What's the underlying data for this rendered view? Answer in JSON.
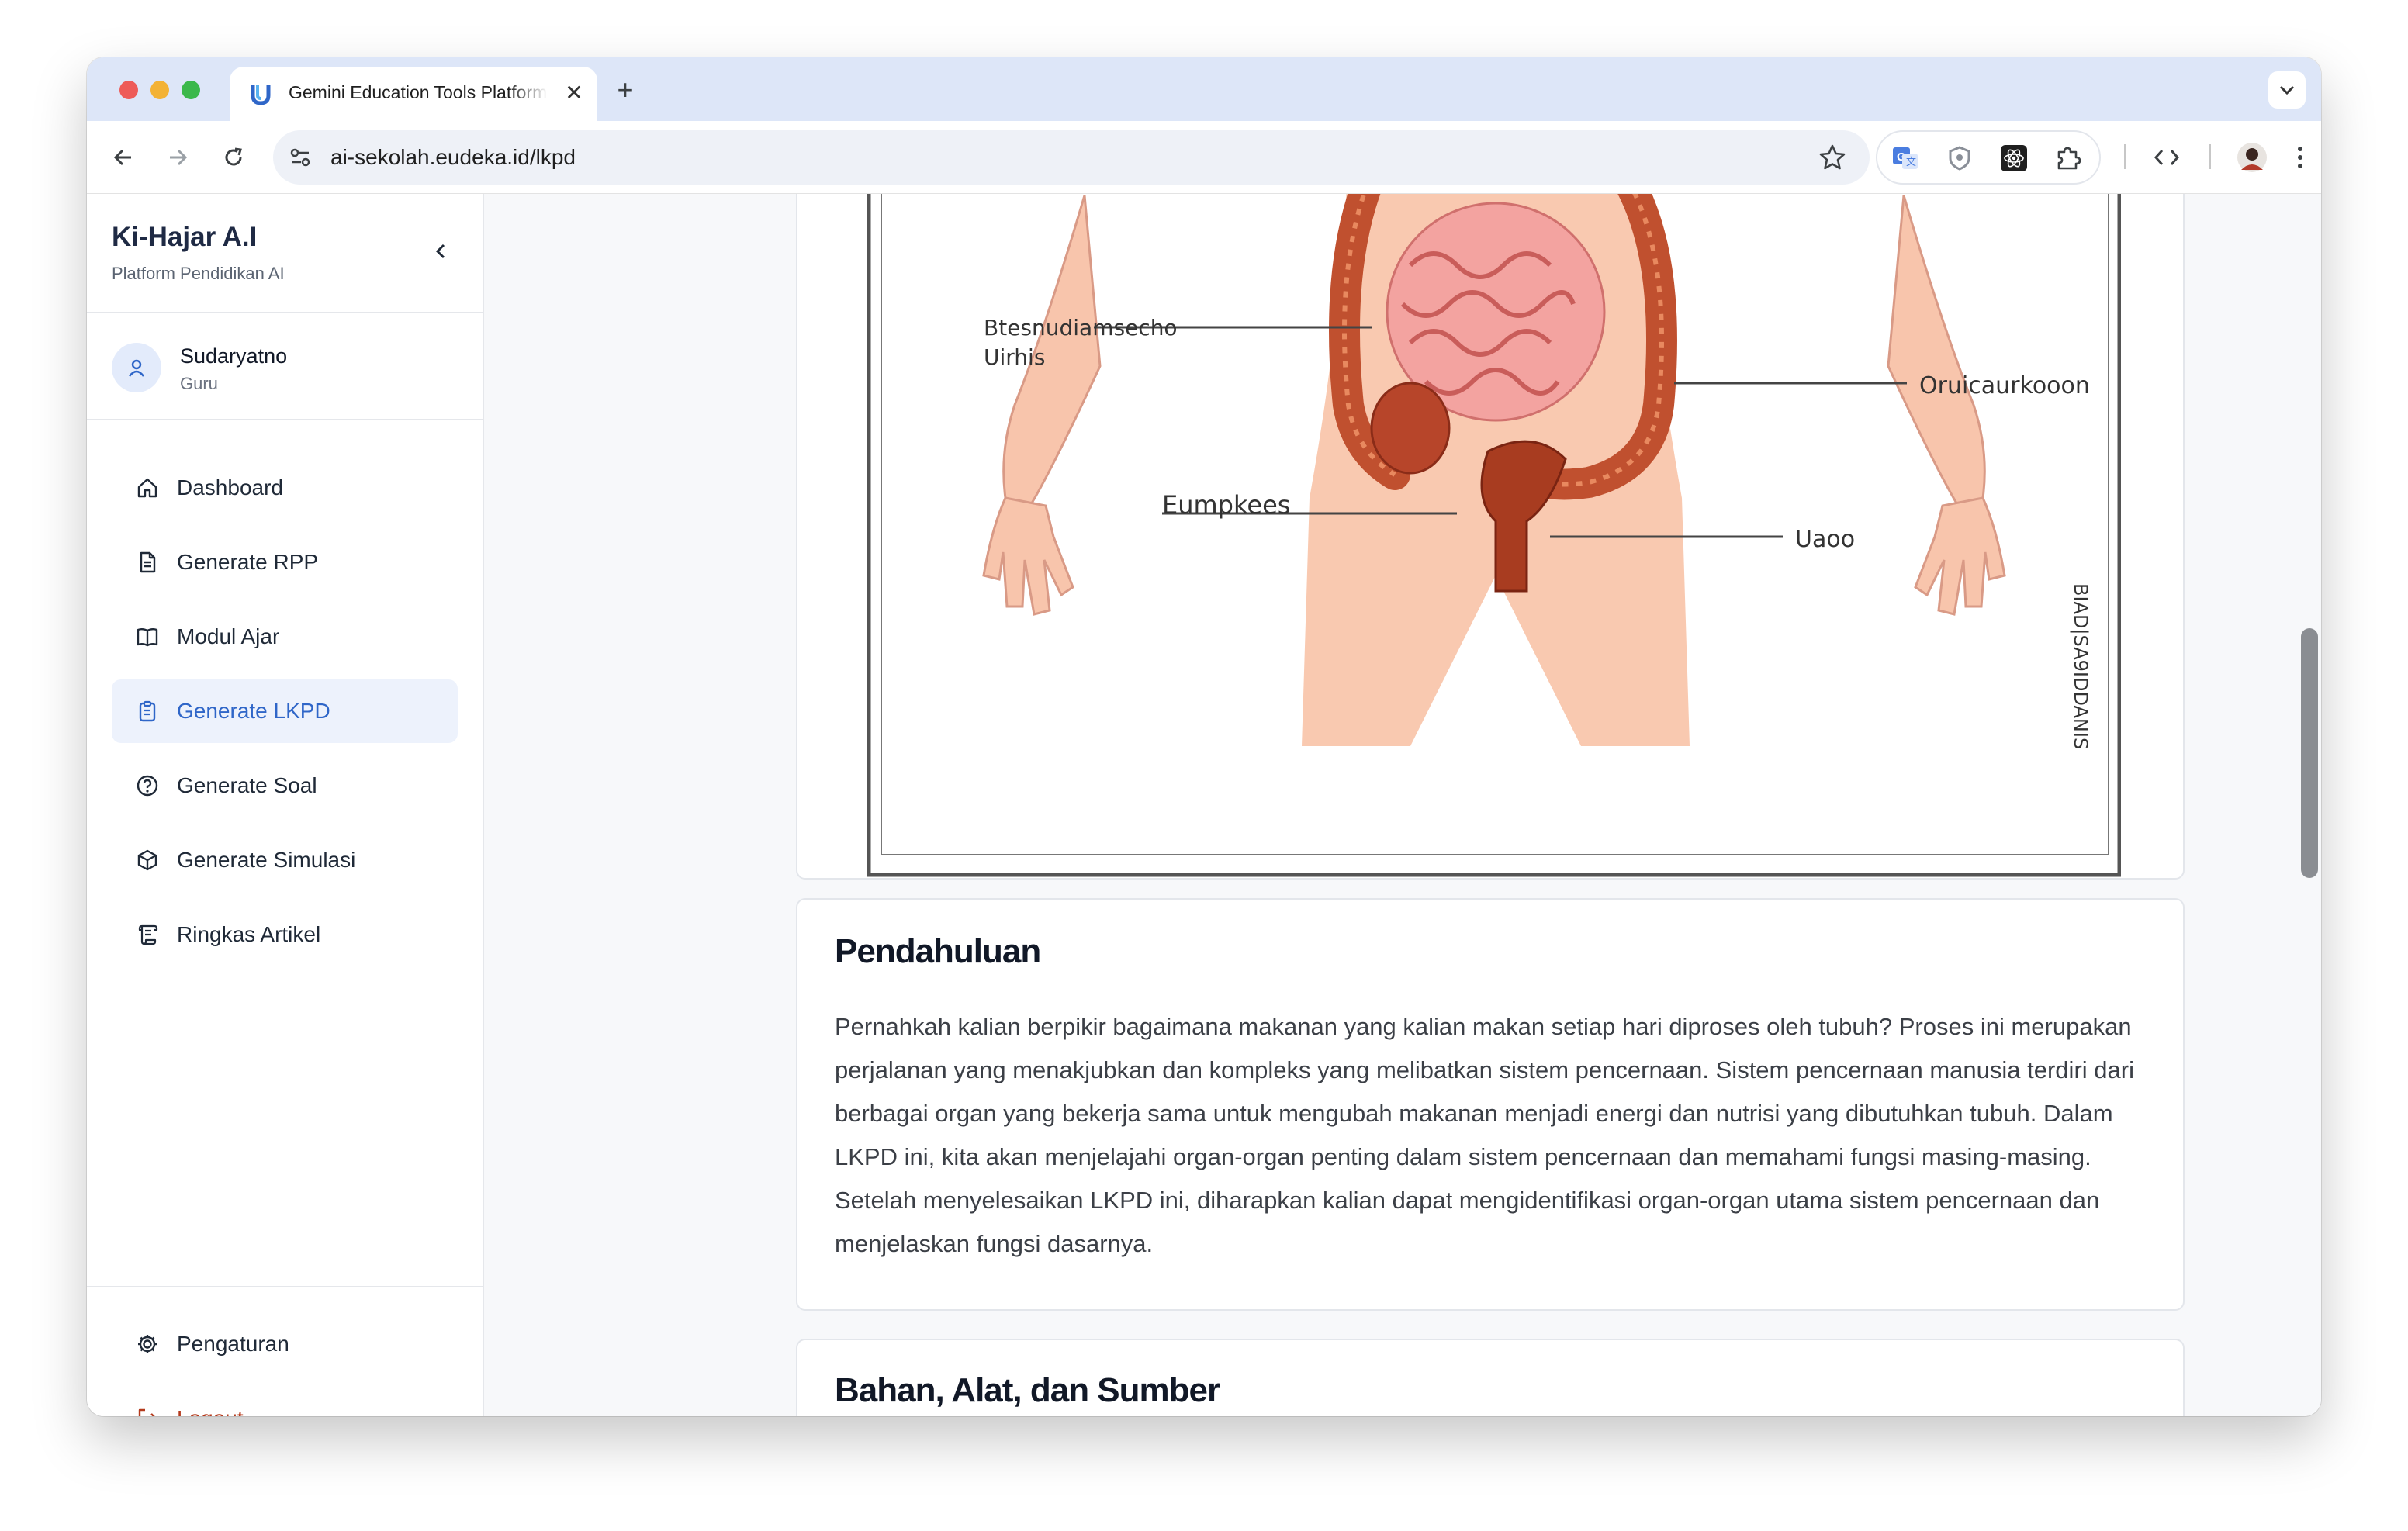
{
  "browser": {
    "tab_title": "Gemini Education Tools Platform",
    "url": "ai-sekolah.eudeka.id/lkpd"
  },
  "sidebar": {
    "brand": "Ki-Hajar A.I",
    "tagline": "Platform Pendidikan AI",
    "user": {
      "name": "Sudaryatno",
      "role": "Guru"
    },
    "items": [
      {
        "label": "Dashboard",
        "icon": "home-icon"
      },
      {
        "label": "Generate RPP",
        "icon": "document-icon"
      },
      {
        "label": "Modul Ajar",
        "icon": "book-icon"
      },
      {
        "label": "Generate LKPD",
        "icon": "clipboard-icon",
        "active": true
      },
      {
        "label": "Generate Soal",
        "icon": "question-circle-icon"
      },
      {
        "label": "Generate Simulasi",
        "icon": "cube-icon"
      },
      {
        "label": "Ringkas Artikel",
        "icon": "scroll-icon"
      }
    ],
    "footer": [
      {
        "label": "Pengaturan",
        "icon": "gear-icon"
      },
      {
        "label": "Logout",
        "icon": "logout-icon"
      }
    ]
  },
  "content": {
    "illustration_labels": {
      "label_1": "Btesnudiamsecho",
      "label_1b": "Uirhis",
      "label_2": "Oruicaurkooon",
      "label_3": "Eumpkees",
      "label_4": "Uaoo",
      "label_5": "BIAD|SA9IDDANIS"
    },
    "intro": {
      "heading": "Pendahuluan",
      "body": "Pernahkah kalian berpikir bagaimana makanan yang kalian makan setiap hari diproses oleh tubuh? Proses ini merupakan perjalanan yang menakjubkan dan kompleks yang melibatkan sistem pencernaan. Sistem pencernaan manusia terdiri dari berbagai organ yang bekerja sama untuk mengubah makanan menjadi energi dan nutrisi yang dibutuhkan tubuh. Dalam LKPD ini, kita akan menjelajahi organ-organ penting dalam sistem pencernaan dan memahami fungsi masing-masing. Setelah menyelesaikan LKPD ini, diharapkan kalian dapat mengidentifikasi organ-organ utama sistem pencernaan dan menjelaskan fungsi dasarnya."
    },
    "materials": {
      "heading": "Bahan, Alat, dan Sumber"
    }
  },
  "colors": {
    "accent": "#2f66c8",
    "active_bg": "#edf2fc",
    "logout": "#b43a1c",
    "tabbar": "#dde6f8"
  }
}
